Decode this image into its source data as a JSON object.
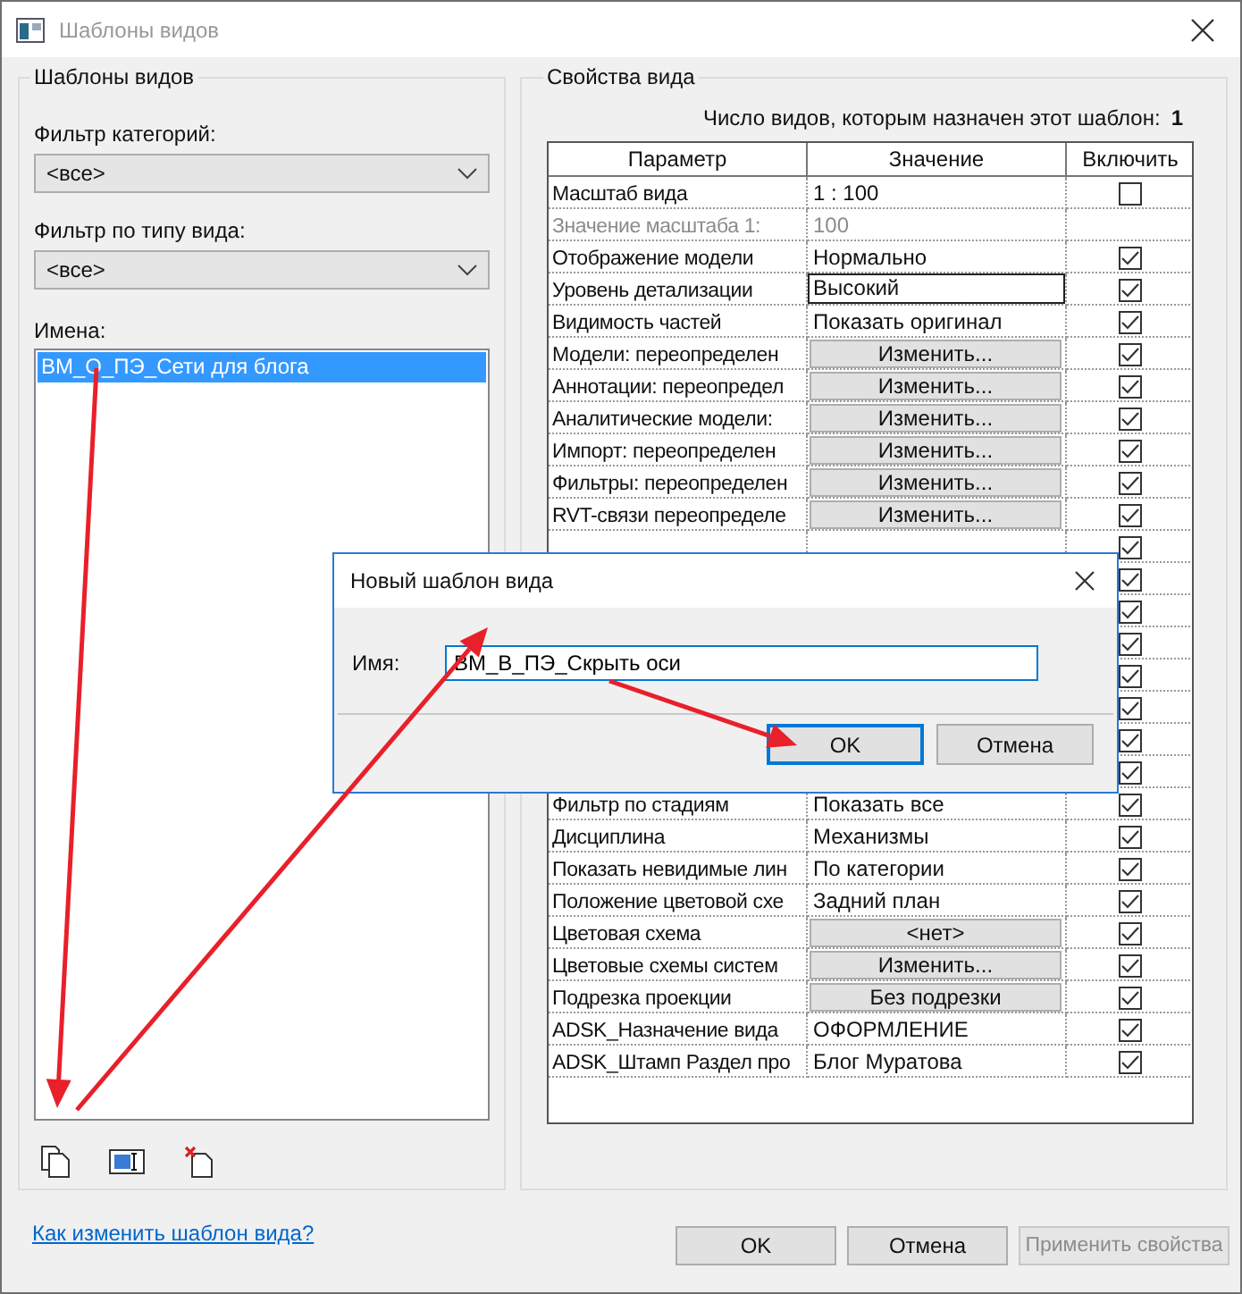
{
  "window": {
    "title": "Шаблоны видов"
  },
  "left": {
    "group_title": "Шаблоны видов",
    "category_filter": {
      "label": "Фильтр категорий:",
      "value": "<все>"
    },
    "type_filter": {
      "label": "Фильтр по типу вида:",
      "value": "<все>"
    },
    "names": {
      "label": "Имена:",
      "items": [
        {
          "text": "ВМ_О_ПЭ_Сети для блога",
          "selected": true
        }
      ]
    },
    "help_link": "Как изменить шаблон вида?"
  },
  "right": {
    "group_title": "Свойства вида",
    "count_label": "Число видов, которым назначен этот шаблон:",
    "count_value": "1",
    "columns": [
      "Параметр",
      "Значение",
      "Включить"
    ],
    "rows": [
      {
        "parameter": "Масштаб вида",
        "value": "1 : 100",
        "kind": "text",
        "include": false
      },
      {
        "parameter": "Значение масштаба    1:",
        "value": "100",
        "kind": "disabled"
      },
      {
        "parameter": "Отображение модели",
        "value": "Нормально",
        "kind": "text",
        "include": true
      },
      {
        "parameter": "Уровень детализации",
        "value": "Высокий",
        "kind": "field",
        "include": true
      },
      {
        "parameter": "Видимость частей",
        "value": "Показать оригинал",
        "kind": "text",
        "include": true
      },
      {
        "parameter": "Модели: переопределен",
        "value": "Изменить...",
        "kind": "button",
        "include": true
      },
      {
        "parameter": "Аннотации: переопредел",
        "value": "Изменить...",
        "kind": "button",
        "include": true
      },
      {
        "parameter": "Аналитические модели:",
        "value": "Изменить...",
        "kind": "button",
        "include": true
      },
      {
        "parameter": "Импорт: переопределен",
        "value": "Изменить...",
        "kind": "button",
        "include": true
      },
      {
        "parameter": "Фильтры: переопределен",
        "value": "Изменить...",
        "kind": "button",
        "include": true
      },
      {
        "parameter": "RVT-связи переопределе",
        "value": "Изменить...",
        "kind": "button",
        "include": true
      },
      {
        "include": true
      },
      {
        "include": true
      },
      {
        "include": true
      },
      {
        "include": true
      },
      {
        "include": true
      },
      {
        "include": true
      },
      {
        "include": true
      },
      {
        "include": true
      },
      {
        "parameter": "Фильтр по стадиям",
        "value": "Показать все",
        "kind": "text",
        "include": true
      },
      {
        "parameter": "Дисциплина",
        "value": "Механизмы",
        "kind": "text",
        "include": true
      },
      {
        "parameter": "Показать невидимые лин",
        "value": "По категории",
        "kind": "text",
        "include": true
      },
      {
        "parameter": "Положение цветовой схе",
        "value": "Задний план",
        "kind": "text",
        "include": true
      },
      {
        "parameter": "Цветовая схема",
        "value": "<нет>",
        "kind": "button",
        "include": true
      },
      {
        "parameter": "Цветовые схемы систем",
        "value": "Изменить...",
        "kind": "button",
        "include": true
      },
      {
        "parameter": "Подрезка проекции",
        "value": "Без подрезки",
        "kind": "button",
        "include": true
      },
      {
        "parameter": "ADSK_Назначение вида",
        "value": "ОФОРМЛЕНИЕ",
        "kind": "text",
        "include": true
      },
      {
        "parameter": "ADSK_Штамп Раздел про",
        "value": "Блог Муратова",
        "kind": "text",
        "include": true
      }
    ]
  },
  "buttons": [
    {
      "label": "OK",
      "disabled": false
    },
    {
      "label": "Отмена",
      "disabled": false
    },
    {
      "label": "Применить свойства",
      "disabled": true
    }
  ],
  "dialog": {
    "title": "Новый шаблон вида",
    "name_label": "Имя:",
    "name_value": "ВМ_В_ПЭ_Скрыть оси",
    "buttons": [
      {
        "label": "OK",
        "selected": true
      },
      {
        "label": "Отмена",
        "selected": false
      }
    ]
  }
}
